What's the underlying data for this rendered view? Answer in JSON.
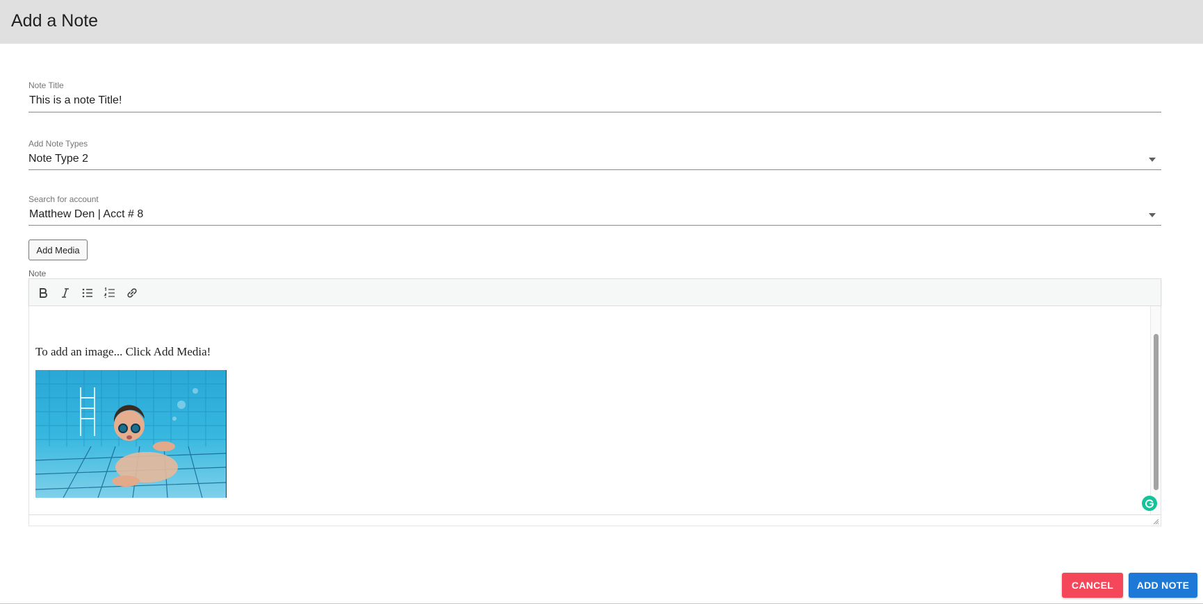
{
  "dialog": {
    "title": "Add a Note"
  },
  "fields": {
    "note_title": {
      "label": "Note Title",
      "value": "This is a note Title!"
    },
    "note_types": {
      "label": "Add Note Types",
      "value": "Note Type 2"
    },
    "account": {
      "label": "Search for account",
      "value": "Matthew Den | Acct # 8"
    }
  },
  "add_media_label": "Add Media",
  "note": {
    "label": "Note",
    "toolbar": [
      "bold-icon",
      "italic-icon",
      "bullet-list-icon",
      "numbered-list-icon",
      "link-icon"
    ],
    "body_text": "To add an image... Click Add Media!"
  },
  "actions": {
    "cancel_label": "CANCEL",
    "add_label": "ADD NOTE"
  },
  "colors": {
    "header_bg": "#e0e0e0",
    "cancel": "#f44759",
    "primary": "#1e78d6",
    "grammarly": "#15c39a"
  }
}
